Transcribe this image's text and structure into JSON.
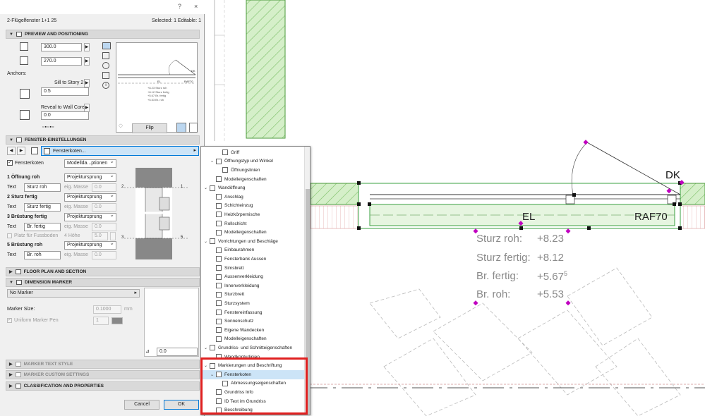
{
  "dialog": {
    "title": "2-Flügelfenster 1+1 25",
    "help": "?",
    "close": "×",
    "selection_info": "Selected: 1 Editable: 1",
    "preview_section": {
      "header": "PREVIEW AND POSITIONING",
      "width_value": "300.0",
      "height_value": "270.0",
      "anchors_label": "Anchors:",
      "sill_label": "Sill to Story 2",
      "sill_value": "0.5",
      "reveal_label": "Reveal to Wall Core",
      "reveal_value": "0.0",
      "flip_label": "Flip",
      "preview_labels": {
        "el": "EL",
        "dk": "DK",
        "raf": "RAF70"
      },
      "preview_annotations": [
        "+8.23",
        "+8.12",
        "+5.67",
        "+5.53"
      ],
      "preview_annotation_labels": [
        "Sturz roh",
        "Sturz fertig",
        "Br. fertig",
        "Br. roh"
      ]
    },
    "fenster_section": {
      "header": "FENSTER-EINSTELLUNGEN",
      "page_select": "Fensterkoten...",
      "checkbox_label": "Fensterkoten",
      "model_select": "Modellda...ptionen",
      "rows": [
        {
          "title": "1 Öffnung roh",
          "ref": "Projektursprung",
          "text_label": "Text",
          "text": "Sturz roh",
          "measure_label": "eig. Masse",
          "measure": "0.0",
          "marker": "2"
        },
        {
          "title": "2 Sturz fertig",
          "ref": "Projektursprung",
          "text_label": "Text",
          "text": "Sturz fertig",
          "measure_label": "eig. Masse",
          "measure": "0.0",
          "marker": "1"
        },
        {
          "title": "3 Brüstung fertig",
          "ref": "Projektursprung",
          "text_label": "Text",
          "text": "Br. fertig",
          "measure_label": "eig. Masse",
          "measure": "0.0",
          "marker": "3"
        },
        {
          "title": "5 Brüstung roh",
          "ref": "Projektursprung",
          "text_label": "Text",
          "text": "Br. roh",
          "measure_label": "eig. Masse",
          "measure": "0.0",
          "marker": "5"
        }
      ],
      "platz_label": "Platz für Fussboden",
      "hoehe_label": "4 Höhe",
      "hoehe_value": "5.0",
      "marker_right_top": "1",
      "marker_right_bottom": "5"
    },
    "floor_plan_header": "FLOOR PLAN AND SECTION",
    "dimension_marker": {
      "header": "DIMENSION MARKER",
      "marker_select": "No Marker",
      "marker_size_label": "Marker Size:",
      "marker_size_value": "0.1000",
      "marker_size_unit": "mm",
      "uniform_pen_label": "Uniform Marker Pen",
      "pen_value": "1",
      "angle_value": "0.0"
    },
    "collapsed_sections": [
      "MARKER TEXT STYLE",
      "MARKER CUSTOM SETTINGS",
      "CLASSIFICATION AND PROPERTIES"
    ],
    "cancel_label": "Cancel",
    "ok_label": "OK"
  },
  "tree": {
    "items": [
      {
        "label": "Griff",
        "level": 2,
        "chev": ""
      },
      {
        "label": "Öffnungstyp und Winkel",
        "level": 1,
        "chev": "v"
      },
      {
        "label": "Öffnungslinien",
        "level": 2,
        "chev": ""
      },
      {
        "label": "Modelleigenschaften",
        "level": 1,
        "chev": ""
      },
      {
        "label": "Wandöffnung",
        "level": 0,
        "chev": "v"
      },
      {
        "label": "Anschlag",
        "level": 1,
        "chev": ""
      },
      {
        "label": "Schichteinzug",
        "level": 1,
        "chev": ""
      },
      {
        "label": "Heizkörpernische",
        "level": 1,
        "chev": ""
      },
      {
        "label": "Rollschicht",
        "level": 1,
        "chev": ""
      },
      {
        "label": "Modelleigenschaften",
        "level": 1,
        "chev": ""
      },
      {
        "label": "Vorrichtungen und Beschläge",
        "level": 0,
        "chev": "v"
      },
      {
        "label": "Einbaurahmen",
        "level": 1,
        "chev": ""
      },
      {
        "label": "Fensterbank Aussen",
        "level": 1,
        "chev": ""
      },
      {
        "label": "Simsbrett",
        "level": 1,
        "chev": ""
      },
      {
        "label": "Aussenverkleidung",
        "level": 1,
        "chev": ""
      },
      {
        "label": "Innenverkleidung",
        "level": 1,
        "chev": ""
      },
      {
        "label": "Sturzbrett",
        "level": 1,
        "chev": ""
      },
      {
        "label": "Sturzsystem",
        "level": 1,
        "chev": ""
      },
      {
        "label": "Fenstereinfassung",
        "level": 1,
        "chev": ""
      },
      {
        "label": "Sonnenschutz",
        "level": 1,
        "chev": ""
      },
      {
        "label": "Eigene Wandecken",
        "level": 1,
        "chev": ""
      },
      {
        "label": "Modelleigenschaften",
        "level": 1,
        "chev": ""
      },
      {
        "label": "Grundriss- und Schnitteigenschaften",
        "level": 0,
        "chev": "v"
      },
      {
        "label": "Wandkonturlinien",
        "level": 1,
        "chev": ""
      },
      {
        "label": "Markierungen und Beschriftung",
        "level": 0,
        "chev": "v"
      },
      {
        "label": "Fensterkoten",
        "level": 1,
        "chev": "v",
        "selected": true
      },
      {
        "label": "Abmessungseigenschaften",
        "level": 2,
        "chev": ""
      },
      {
        "label": "Grundriss Info",
        "level": 1,
        "chev": ""
      },
      {
        "label": "ID Text im Grundriss",
        "level": 1,
        "chev": ""
      },
      {
        "label": "Beschreibung",
        "level": 1,
        "chev": ""
      }
    ]
  },
  "canvas": {
    "dk_label": "DK",
    "el_label": "EL",
    "raf_label": "RAF70",
    "annotations": [
      {
        "label": "Sturz roh:",
        "value": "+8.23"
      },
      {
        "label": "Sturz fertig:",
        "value": "+8.12"
      },
      {
        "label": "Br. fertig:",
        "value": "+5.67",
        "sup": "5"
      },
      {
        "label": "Br. roh:",
        "value": "+5.53"
      }
    ]
  },
  "colors": {
    "highlight_box": "#e02020",
    "selection": "#cce4f7",
    "wall_hatch": "#8fd17a",
    "marker": "#c000c0"
  }
}
